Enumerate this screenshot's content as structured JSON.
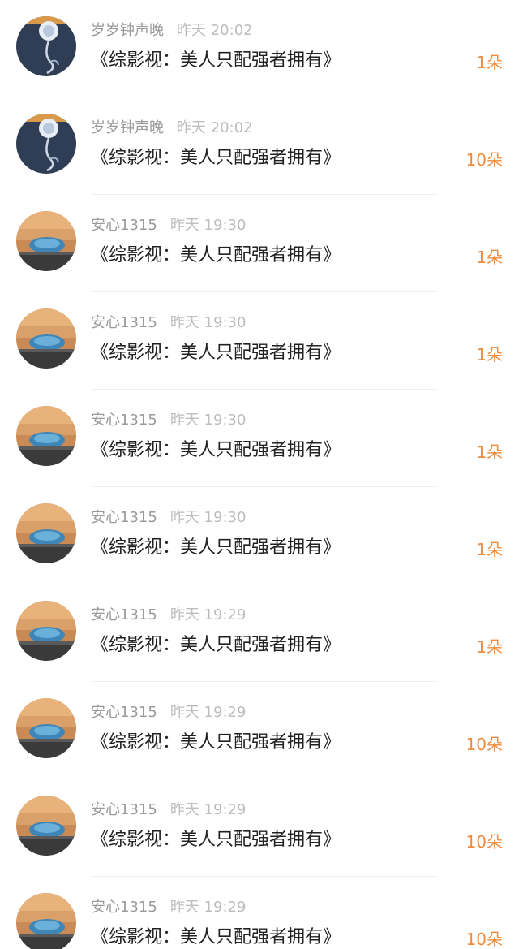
{
  "gift_list": {
    "colors": {
      "amount": "#f08a3c",
      "username": "#9a9a9a",
      "time": "#bdbdbd",
      "title": "#222222"
    },
    "items": [
      {
        "user": "岁岁钟声晚",
        "time": "昨天 20:02",
        "title": "《综影视：美人只配强者拥有》",
        "amount": "1朵",
        "avatar": "crystal-flower-avatar"
      },
      {
        "user": "岁岁钟声晚",
        "time": "昨天 20:02",
        "title": "《综影视：美人只配强者拥有》",
        "amount": "10朵",
        "avatar": "crystal-flower-avatar"
      },
      {
        "user": "安心1315",
        "time": "昨天 19:30",
        "title": "《综影视：美人只配强者拥有》",
        "amount": "1朵",
        "avatar": "sunset-stadium-avatar"
      },
      {
        "user": "安心1315",
        "time": "昨天 19:30",
        "title": "《综影视：美人只配强者拥有》",
        "amount": "1朵",
        "avatar": "sunset-stadium-avatar"
      },
      {
        "user": "安心1315",
        "time": "昨天 19:30",
        "title": "《综影视：美人只配强者拥有》",
        "amount": "1朵",
        "avatar": "sunset-stadium-avatar"
      },
      {
        "user": "安心1315",
        "time": "昨天 19:30",
        "title": "《综影视：美人只配强者拥有》",
        "amount": "1朵",
        "avatar": "sunset-stadium-avatar"
      },
      {
        "user": "安心1315",
        "time": "昨天 19:29",
        "title": "《综影视：美人只配强者拥有》",
        "amount": "1朵",
        "avatar": "sunset-stadium-avatar"
      },
      {
        "user": "安心1315",
        "time": "昨天 19:29",
        "title": "《综影视：美人只配强者拥有》",
        "amount": "10朵",
        "avatar": "sunset-stadium-avatar"
      },
      {
        "user": "安心1315",
        "time": "昨天 19:29",
        "title": "《综影视：美人只配强者拥有》",
        "amount": "10朵",
        "avatar": "sunset-stadium-avatar"
      },
      {
        "user": "安心1315",
        "time": "昨天 19:29",
        "title": "《综影视：美人只配强者拥有》",
        "amount": "10朵",
        "avatar": "sunset-stadium-avatar"
      }
    ]
  }
}
